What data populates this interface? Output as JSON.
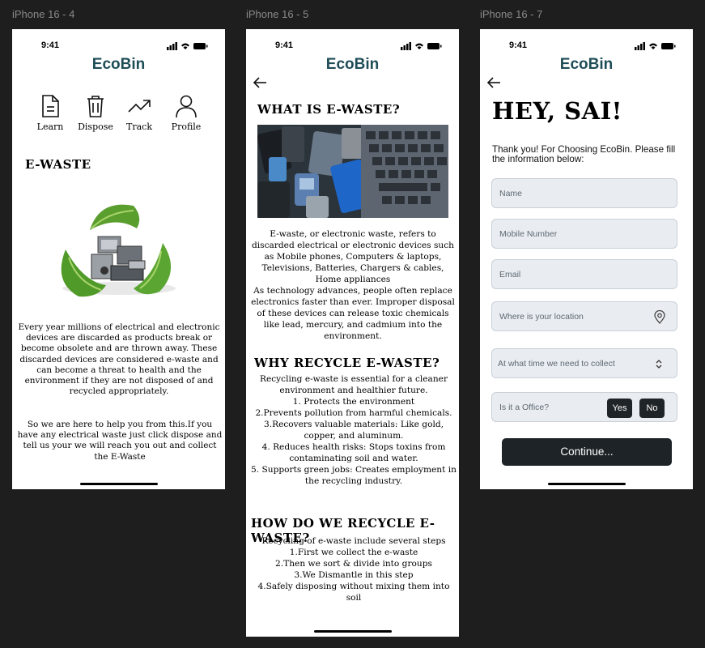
{
  "frames": {
    "s4": "iPhone 16 - 4",
    "s5": "iPhone 16 - 5",
    "s7": "iPhone 16 - 7"
  },
  "status_time": "9:41",
  "brand": "EcoBin",
  "screen4": {
    "nav": [
      {
        "label": "Learn",
        "icon": "document-icon"
      },
      {
        "label": "Dispose",
        "icon": "trash-icon"
      },
      {
        "label": "Track",
        "icon": "trend-up-icon"
      },
      {
        "label": "Profile",
        "icon": "user-icon"
      }
    ],
    "title": "E-WASTE",
    "para1": "Every year millions of electrical and electronic devices are discarded as products break or become obsolete and are thrown away. These discarded devices are considered e-waste and can become a threat to health and the environment if they are not disposed of and recycled appropriately.",
    "para2": "So we are here to help you from this.If you have any electrical waste just click dispose and tell us your we will reach you out and collect the E-Waste"
  },
  "screen5": {
    "h1": "WHAT IS E-WASTE?",
    "p1": "E-waste, or electronic waste, refers to discarded electrical or electronic devices such as Mobile phones, Computers & laptops, Televisions, Batteries, Chargers & cables, Home appliances\nAs technology advances, people often replace electronics faster than ever. Improper disposal of these devices can release toxic chemicals like lead, mercury, and cadmium into the environment.",
    "h2": "WHY RECYCLE E-WASTE?",
    "p2": "Recycling e-waste is essential for a cleaner environment and healthier future.\n1. Protects the environment\n2.Prevents pollution from harmful chemicals.\n3.Recovers valuable materials: Like gold, copper, and aluminum.\n4. Reduces health risks: Stops toxins from contaminating soil and water.\n5. Supports green jobs: Creates employment in the recycling industry.",
    "h3": "HOW DO WE RECYCLE E-WASTE?",
    "p3": "Recycling of e-waste include several steps\n1.First we collect the e-waste\n2.Then we sort & divide into groups\n3.We Dismantle in this step\n4.Safely disposing without mixing them into soil"
  },
  "screen7": {
    "greeting": "HEY, SAI!",
    "intro": "Thank you! For Choosing EcoBin. Please fill the information below:",
    "name_ph": "Name",
    "mobile_ph": "Mobile Number",
    "email_ph": "Email",
    "location_ph": "Where is your location",
    "time_ph": "At what time we need to collect",
    "office_q": "Is it a Office?",
    "yes": "Yes",
    "no": "No",
    "continue": "Continue..."
  }
}
